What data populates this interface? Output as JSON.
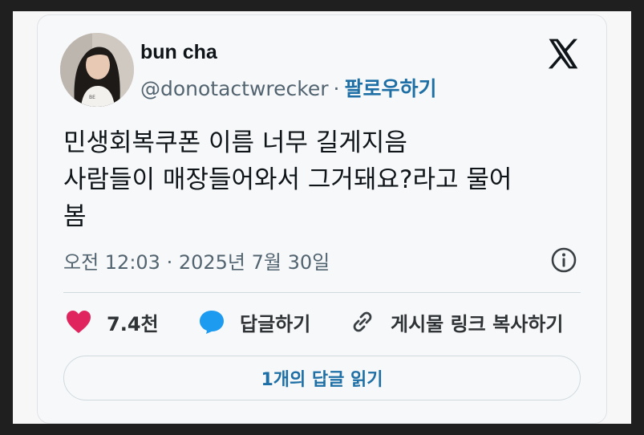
{
  "user": {
    "display_name": "bun cha",
    "handle": "@donotactwrecker",
    "follow_label": "팔로우하기"
  },
  "brand_icon": "x-logo-icon",
  "tweet": {
    "lines": [
      "민생회복쿠폰 이름 너무 길게지음",
      "사람들이 매장들어와서 그거돼요?라고 물어",
      "봄"
    ],
    "timestamp": "오전 12:03 · 2025년 7월 30일"
  },
  "actions": {
    "like_count": "7.4천",
    "reply_label": "답글하기",
    "copy_link_label": "게시물 링크 복사하기"
  },
  "read_replies_label": "1개의 답글 읽기",
  "colors": {
    "accent": "#1d6fa5",
    "like": "#e0245e",
    "reply_bubble": "#1d9bf0",
    "text": "#0f1419",
    "muted": "#536471"
  }
}
